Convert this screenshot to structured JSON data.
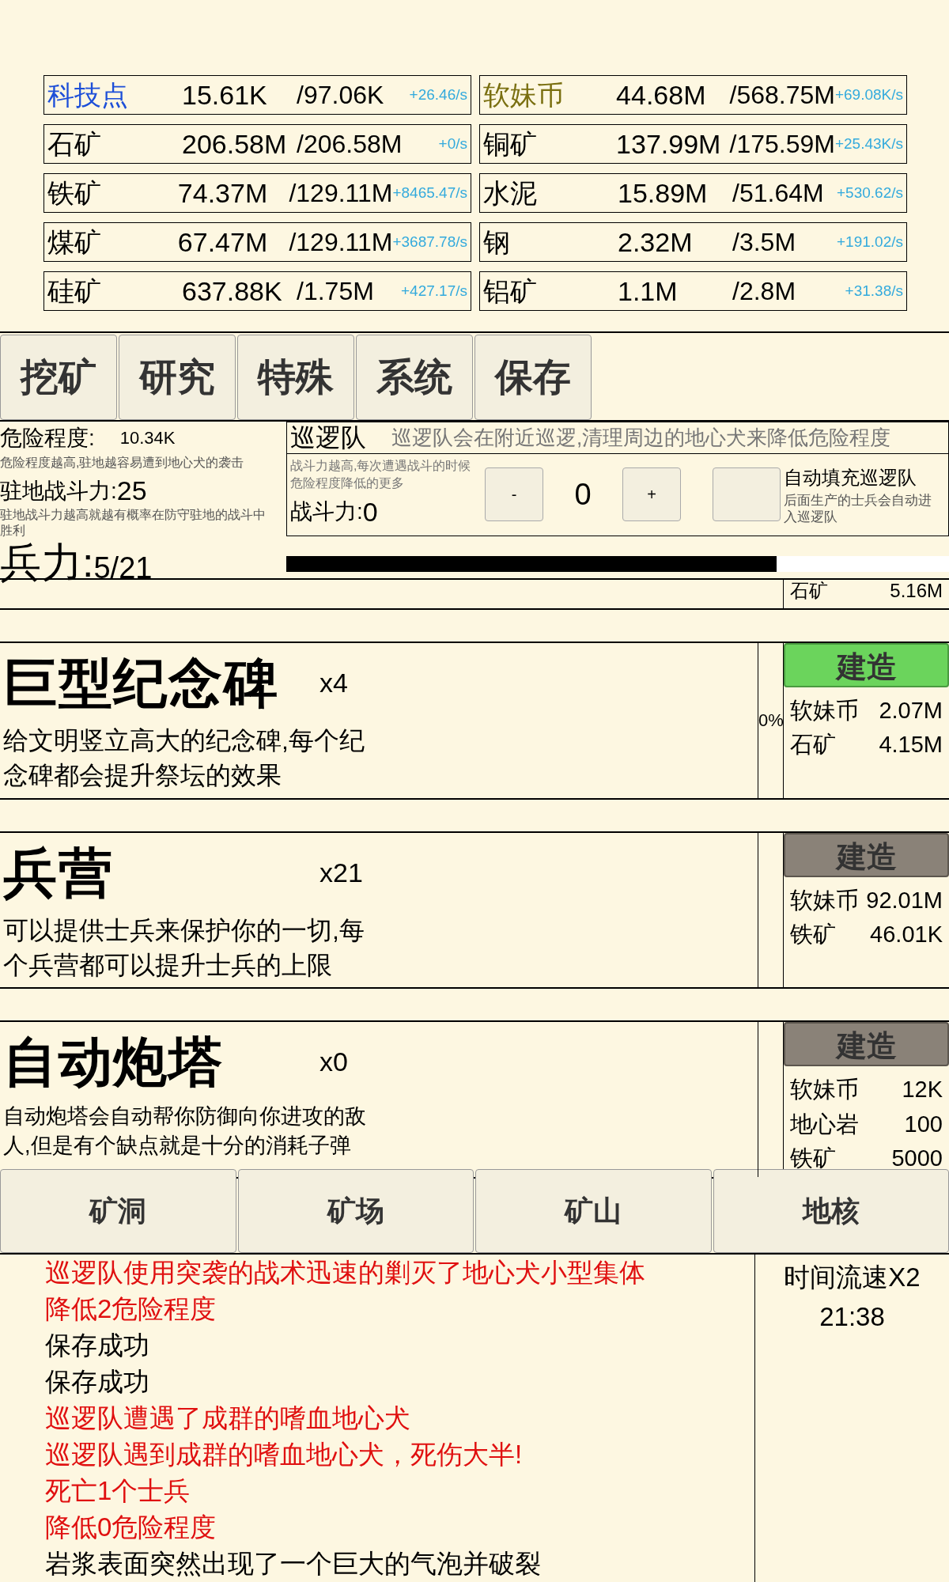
{
  "resources": [
    {
      "name": "科技点",
      "kind": "tech",
      "amount": "15.61K",
      "cap": "/97.06K",
      "rate": "+26.46/s"
    },
    {
      "name": "软妹币",
      "kind": "money",
      "amount": "44.68M",
      "cap": "/568.75M",
      "rate": "+69.08K/s"
    },
    {
      "name": "石矿",
      "kind": "plain",
      "amount": "206.58M",
      "cap": "/206.58M",
      "rate": "+0/s"
    },
    {
      "name": "铜矿",
      "kind": "plain",
      "amount": "137.99M",
      "cap": "/175.59M",
      "rate": "+25.43K/s"
    },
    {
      "name": "铁矿",
      "kind": "plain",
      "amount": "74.37M",
      "cap": "/129.11M",
      "rate": "+8465.47/s"
    },
    {
      "name": "水泥",
      "kind": "plain",
      "amount": "15.89M",
      "cap": "/51.64M",
      "rate": "+530.62/s"
    },
    {
      "name": "煤矿",
      "kind": "plain",
      "amount": "67.47M",
      "cap": "/129.11M",
      "rate": "+3687.78/s"
    },
    {
      "name": "钢",
      "kind": "plain",
      "amount": "2.32M",
      "cap": "/3.5M",
      "rate": "+191.02/s"
    },
    {
      "name": "硅矿",
      "kind": "plain",
      "amount": "637.88K",
      "cap": "/1.75M",
      "rate": "+427.17/s"
    },
    {
      "name": "铝矿",
      "kind": "plain",
      "amount": "1.1M",
      "cap": "/2.8M",
      "rate": "+31.38/s"
    }
  ],
  "main_tabs": [
    {
      "label": "挖矿",
      "selected": false
    },
    {
      "label": "研究",
      "selected": false
    },
    {
      "label": "特殊",
      "selected": false
    },
    {
      "label": "系统",
      "selected": false
    },
    {
      "label": "保存",
      "selected": false
    }
  ],
  "defense": {
    "danger_label": "危险程度:",
    "danger_value": "10.34K",
    "danger_hint": "危险程度越高,驻地越容易遭到地心犬的袭击",
    "garrison_label": "驻地战斗力:",
    "garrison_value": "25",
    "garrison_hint": "驻地战斗力越高就越有概率在防守驻地的战斗中胜利",
    "troops_label": "兵力:",
    "troops_value": "5/21"
  },
  "patrol": {
    "title": "巡逻队",
    "description": "巡逻队会在附近巡逻,清理周边的地心犬来降低危险程度",
    "hint": "战斗力越高,每次遭遇战斗的时候危险程度降低的更多",
    "power_label": "战斗力:",
    "power_value": "0",
    "minus": "-",
    "count": "0",
    "plus": "+",
    "autofill": {
      "checked": false,
      "label": "自动填充巡逻队",
      "hint": "后面生产的士兵会自动进入巡逻队"
    },
    "level": 0.74
  },
  "partial_cost": {
    "name": "石矿",
    "value": "5.16M"
  },
  "buildings": [
    {
      "name": "巨型纪念碑",
      "count": "x4",
      "description": "给文明竖立高大的纪念碑,每个纪念碑都会提升祭坛的效果",
      "percent": "0%",
      "button": "建造",
      "affordable": true,
      "costs": [
        {
          "name": "软妹币",
          "value": "2.07M"
        },
        {
          "name": "石矿",
          "value": "4.15M"
        }
      ]
    },
    {
      "name": "兵营",
      "count": "x21",
      "description": "可以提供士兵来保护你的一切,每个兵营都可以提升士兵的上限",
      "button": "建造",
      "affordable": false,
      "costs": [
        {
          "name": "软妹币",
          "value": "92.01M"
        },
        {
          "name": "铁矿",
          "value": "46.01K"
        }
      ]
    },
    {
      "name": "自动炮塔",
      "count": "x0",
      "description": "自动炮塔会自动帮你防御向你进攻的敌人,但是有个缺点就是十分的消耗子弹",
      "button": "建造",
      "affordable": false,
      "costs": [
        {
          "name": "软妹币",
          "value": "12K"
        },
        {
          "name": "地心岩",
          "value": "100"
        },
        {
          "name": "铁矿",
          "value": "5000"
        }
      ]
    }
  ],
  "area_tabs": [
    {
      "label": "矿洞",
      "selected": false
    },
    {
      "label": "矿场",
      "selected": false
    },
    {
      "label": "矿山",
      "selected": false
    },
    {
      "label": "地核",
      "selected": false
    }
  ],
  "log": [
    {
      "text": "巡逻队使用突袭的战术迅速的剿灭了地心犬小型集体",
      "kind": "alert"
    },
    {
      "text": "降低2危险程度",
      "kind": "alert"
    },
    {
      "text": "保存成功",
      "kind": "info"
    },
    {
      "text": "保存成功",
      "kind": "info"
    },
    {
      "text": "巡逻队遭遇了成群的嗜血地心犬",
      "kind": "alert"
    },
    {
      "text": "巡逻队遇到成群的嗜血地心犬，死伤大半!",
      "kind": "alert"
    },
    {
      "text": "死亡1个士兵",
      "kind": "alert"
    },
    {
      "text": "降低0危险程度",
      "kind": "alert"
    },
    {
      "text": "岩浆表面突然出现了一个巨大的气泡并破裂",
      "kind": "info"
    }
  ],
  "status": {
    "speed": "时间流速X2",
    "time": "21:38"
  }
}
